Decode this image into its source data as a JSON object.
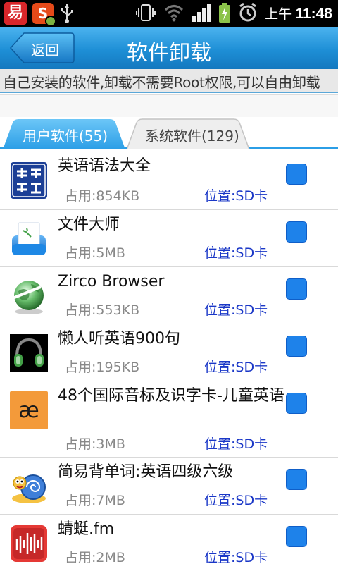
{
  "status_bar": {
    "app_icon_1": "易",
    "app_icon_2": "S",
    "time_prefix": "上午",
    "time": "11:48"
  },
  "header": {
    "back_label": "返回",
    "title": "软件卸载"
  },
  "description": "自己安装的软件,卸载不需要Root权限,可以自由卸载",
  "tabs": [
    {
      "label": "用户软件(55)",
      "active": true
    },
    {
      "label": "系统软件(129)",
      "active": false
    }
  ],
  "apps": [
    {
      "name": "英语语法大全",
      "size": "占用:854KB",
      "location": "位置:SD卡",
      "icon": "english-grammar-icon",
      "checked": true
    },
    {
      "name": "文件大师",
      "size": "占用:5MB",
      "location": "位置:SD卡",
      "icon": "file-master-icon",
      "checked": true
    },
    {
      "name": "Zirco Browser",
      "size": "占用:553KB",
      "location": "位置:SD卡",
      "icon": "zirco-browser-icon",
      "checked": true
    },
    {
      "name": "懒人听英语900句",
      "size": "占用:195KB",
      "location": "位置:SD卡",
      "icon": "headphones-icon",
      "checked": true
    },
    {
      "name": "48个国际音标及识字卡-儿童英语",
      "size": "占用:3MB",
      "location": "位置:SD卡",
      "icon": "phonetic-ae-icon",
      "checked": true
    },
    {
      "name": "简易背单词:英语四级六级",
      "size": "占用:7MB",
      "location": "位置:SD卡",
      "icon": "snail-icon",
      "checked": true
    },
    {
      "name": "蜻蜓.fm",
      "size": "占用:2MB",
      "location": "位置:SD卡",
      "icon": "qingting-fm-icon",
      "checked": true
    }
  ],
  "colors": {
    "header_blue": "#1e8fd6",
    "checkbox_blue": "#1e82ea",
    "location_text": "#1a37c7"
  }
}
